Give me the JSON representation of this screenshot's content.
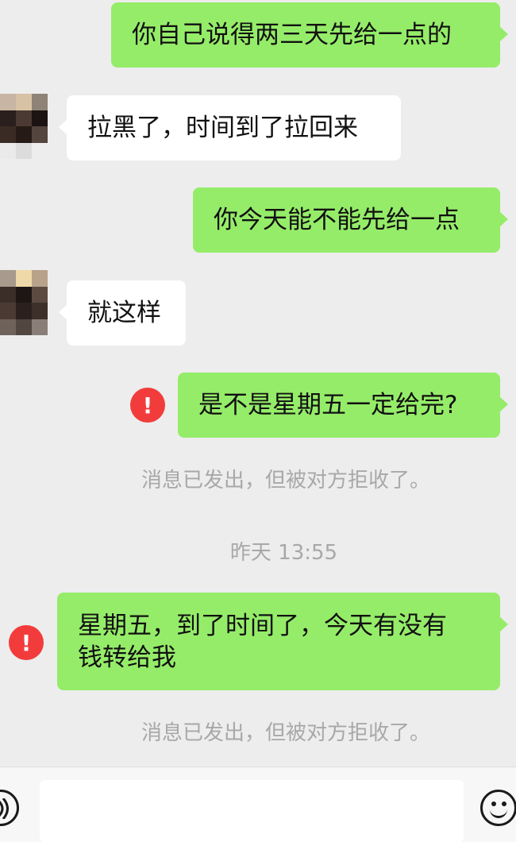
{
  "messages": [
    {
      "text": "你自己说得两三天先给一点的"
    },
    {
      "text": "拉黑了，时间到了拉回来"
    },
    {
      "text": "你今天能不能先给一点"
    },
    {
      "text": "就这样"
    },
    {
      "text": "是不是星期五一定给完?"
    },
    {
      "line1": "星期五，到了时间了，今天有没有",
      "line2": "钱转给我"
    }
  ],
  "system": {
    "rejected_1": "消息已发出，但被对方拒收了。",
    "timestamp": "昨天 13:55",
    "rejected_2": "消息已发出，但被对方拒收了。"
  },
  "error_icon": {
    "glyph": "!"
  },
  "colors": {
    "sent_bubble": "#95ec69",
    "received_bubble": "#ffffff",
    "background": "#ededed",
    "error": "#f23c3c",
    "system_text": "#a8a8a8"
  }
}
